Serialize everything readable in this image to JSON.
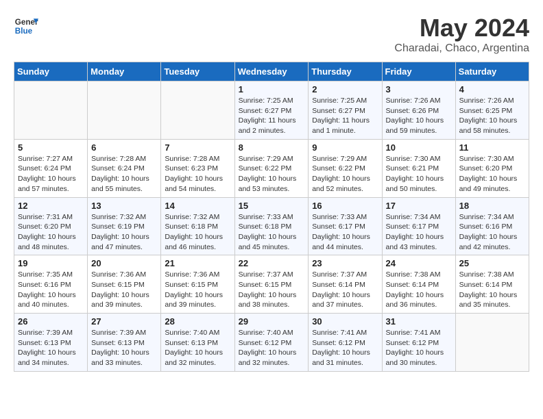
{
  "header": {
    "logo_line1": "General",
    "logo_line2": "Blue",
    "month_title": "May 2024",
    "location": "Charadai, Chaco, Argentina"
  },
  "days_of_week": [
    "Sunday",
    "Monday",
    "Tuesday",
    "Wednesday",
    "Thursday",
    "Friday",
    "Saturday"
  ],
  "weeks": [
    [
      {
        "day": "",
        "detail": ""
      },
      {
        "day": "",
        "detail": ""
      },
      {
        "day": "",
        "detail": ""
      },
      {
        "day": "1",
        "detail": "Sunrise: 7:25 AM\nSunset: 6:27 PM\nDaylight: 11 hours\nand 2 minutes."
      },
      {
        "day": "2",
        "detail": "Sunrise: 7:25 AM\nSunset: 6:27 PM\nDaylight: 11 hours\nand 1 minute."
      },
      {
        "day": "3",
        "detail": "Sunrise: 7:26 AM\nSunset: 6:26 PM\nDaylight: 10 hours\nand 59 minutes."
      },
      {
        "day": "4",
        "detail": "Sunrise: 7:26 AM\nSunset: 6:25 PM\nDaylight: 10 hours\nand 58 minutes."
      }
    ],
    [
      {
        "day": "5",
        "detail": "Sunrise: 7:27 AM\nSunset: 6:24 PM\nDaylight: 10 hours\nand 57 minutes."
      },
      {
        "day": "6",
        "detail": "Sunrise: 7:28 AM\nSunset: 6:24 PM\nDaylight: 10 hours\nand 55 minutes."
      },
      {
        "day": "7",
        "detail": "Sunrise: 7:28 AM\nSunset: 6:23 PM\nDaylight: 10 hours\nand 54 minutes."
      },
      {
        "day": "8",
        "detail": "Sunrise: 7:29 AM\nSunset: 6:22 PM\nDaylight: 10 hours\nand 53 minutes."
      },
      {
        "day": "9",
        "detail": "Sunrise: 7:29 AM\nSunset: 6:22 PM\nDaylight: 10 hours\nand 52 minutes."
      },
      {
        "day": "10",
        "detail": "Sunrise: 7:30 AM\nSunset: 6:21 PM\nDaylight: 10 hours\nand 50 minutes."
      },
      {
        "day": "11",
        "detail": "Sunrise: 7:30 AM\nSunset: 6:20 PM\nDaylight: 10 hours\nand 49 minutes."
      }
    ],
    [
      {
        "day": "12",
        "detail": "Sunrise: 7:31 AM\nSunset: 6:20 PM\nDaylight: 10 hours\nand 48 minutes."
      },
      {
        "day": "13",
        "detail": "Sunrise: 7:32 AM\nSunset: 6:19 PM\nDaylight: 10 hours\nand 47 minutes."
      },
      {
        "day": "14",
        "detail": "Sunrise: 7:32 AM\nSunset: 6:18 PM\nDaylight: 10 hours\nand 46 minutes."
      },
      {
        "day": "15",
        "detail": "Sunrise: 7:33 AM\nSunset: 6:18 PM\nDaylight: 10 hours\nand 45 minutes."
      },
      {
        "day": "16",
        "detail": "Sunrise: 7:33 AM\nSunset: 6:17 PM\nDaylight: 10 hours\nand 44 minutes."
      },
      {
        "day": "17",
        "detail": "Sunrise: 7:34 AM\nSunset: 6:17 PM\nDaylight: 10 hours\nand 43 minutes."
      },
      {
        "day": "18",
        "detail": "Sunrise: 7:34 AM\nSunset: 6:16 PM\nDaylight: 10 hours\nand 42 minutes."
      }
    ],
    [
      {
        "day": "19",
        "detail": "Sunrise: 7:35 AM\nSunset: 6:16 PM\nDaylight: 10 hours\nand 40 minutes."
      },
      {
        "day": "20",
        "detail": "Sunrise: 7:36 AM\nSunset: 6:15 PM\nDaylight: 10 hours\nand 39 minutes."
      },
      {
        "day": "21",
        "detail": "Sunrise: 7:36 AM\nSunset: 6:15 PM\nDaylight: 10 hours\nand 39 minutes."
      },
      {
        "day": "22",
        "detail": "Sunrise: 7:37 AM\nSunset: 6:15 PM\nDaylight: 10 hours\nand 38 minutes."
      },
      {
        "day": "23",
        "detail": "Sunrise: 7:37 AM\nSunset: 6:14 PM\nDaylight: 10 hours\nand 37 minutes."
      },
      {
        "day": "24",
        "detail": "Sunrise: 7:38 AM\nSunset: 6:14 PM\nDaylight: 10 hours\nand 36 minutes."
      },
      {
        "day": "25",
        "detail": "Sunrise: 7:38 AM\nSunset: 6:14 PM\nDaylight: 10 hours\nand 35 minutes."
      }
    ],
    [
      {
        "day": "26",
        "detail": "Sunrise: 7:39 AM\nSunset: 6:13 PM\nDaylight: 10 hours\nand 34 minutes."
      },
      {
        "day": "27",
        "detail": "Sunrise: 7:39 AM\nSunset: 6:13 PM\nDaylight: 10 hours\nand 33 minutes."
      },
      {
        "day": "28",
        "detail": "Sunrise: 7:40 AM\nSunset: 6:13 PM\nDaylight: 10 hours\nand 32 minutes."
      },
      {
        "day": "29",
        "detail": "Sunrise: 7:40 AM\nSunset: 6:12 PM\nDaylight: 10 hours\nand 32 minutes."
      },
      {
        "day": "30",
        "detail": "Sunrise: 7:41 AM\nSunset: 6:12 PM\nDaylight: 10 hours\nand 31 minutes."
      },
      {
        "day": "31",
        "detail": "Sunrise: 7:41 AM\nSunset: 6:12 PM\nDaylight: 10 hours\nand 30 minutes."
      },
      {
        "day": "",
        "detail": ""
      }
    ]
  ]
}
